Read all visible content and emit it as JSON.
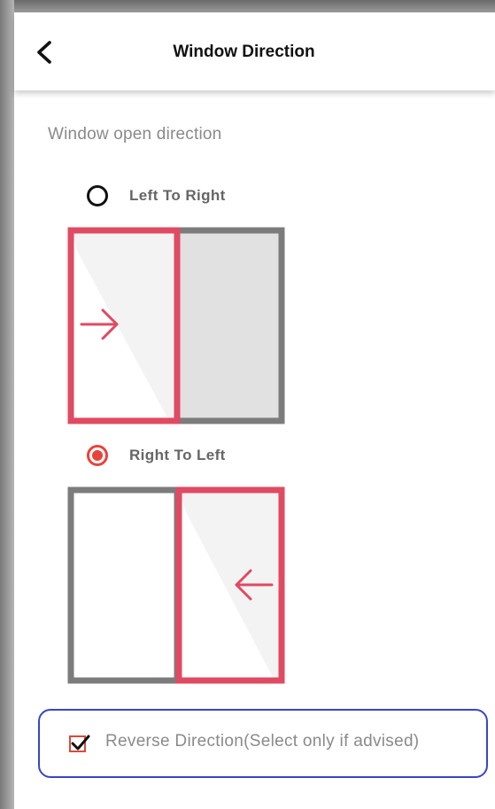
{
  "header": {
    "title": "Window Direction",
    "back_icon": "chevron-left-icon"
  },
  "section": {
    "label": "Window open direction"
  },
  "options": [
    {
      "label": "Left To Right",
      "selected": false
    },
    {
      "label": "Right To Left",
      "selected": true
    }
  ],
  "reverse": {
    "label": "Reverse Direction(Select only if advised)",
    "checked": true
  },
  "colors": {
    "accent_red": "#e8433a",
    "frame_pink": "#e04a62",
    "frame_gray": "#7c7c7c",
    "pane_gray": "#e1e1e1",
    "outline_blue": "#3b45c4"
  }
}
